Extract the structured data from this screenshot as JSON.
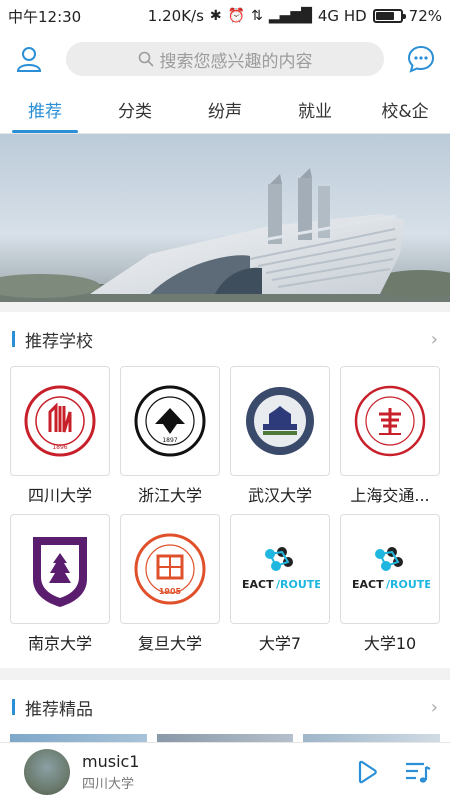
{
  "status_bar": {
    "time": "中午12:30",
    "speed": "1.20K/s",
    "network": "4G HD",
    "battery": "72%"
  },
  "header": {
    "search_placeholder": "搜索您感兴趣的内容"
  },
  "tabs": [
    {
      "label": "推荐",
      "active": true
    },
    {
      "label": "分类",
      "active": false
    },
    {
      "label": "纷声",
      "active": false
    },
    {
      "label": "就业",
      "active": false
    },
    {
      "label": "校&企",
      "active": false
    }
  ],
  "schools_section": {
    "title": "推荐学校",
    "schools": [
      {
        "name": "四川大学",
        "logo": "sichuan-university-seal",
        "color": "#c8202a"
      },
      {
        "name": "浙江大学",
        "logo": "zhejiang-university-seal",
        "color": "#111111"
      },
      {
        "name": "武汉大学",
        "logo": "wuhan-university-seal",
        "color": "#2e3b7a"
      },
      {
        "name": "上海交通...",
        "logo": "sjtu-seal",
        "color": "#c8202a"
      },
      {
        "name": "南京大学",
        "logo": "nanjing-university-seal",
        "color": "#5b1d6e"
      },
      {
        "name": "复旦大学",
        "logo": "fudan-university-seal",
        "color": "#e0502a"
      },
      {
        "name": "大学7",
        "logo": "react-router-logo",
        "color": "#1fb6e0"
      },
      {
        "name": "大学10",
        "logo": "react-router-logo",
        "color": "#1fb6e0"
      }
    ]
  },
  "premium_section": {
    "title": "推荐精品"
  },
  "player": {
    "title": "music1",
    "subtitle": "四川大学"
  },
  "colors": {
    "accent": "#2a8fd6"
  }
}
